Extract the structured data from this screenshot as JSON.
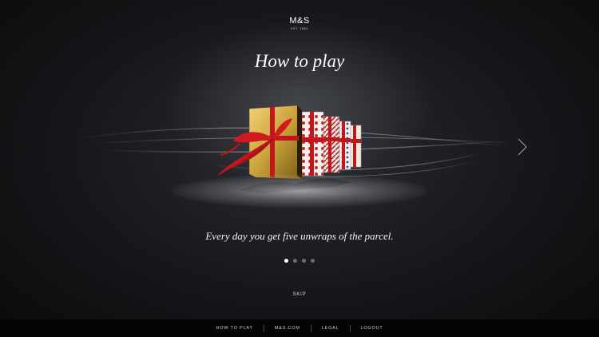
{
  "brand": {
    "name": "M&S",
    "tagline": "EST. 1884"
  },
  "title": "How to play",
  "caption": "Every day you get five unwraps of the parcel.",
  "pagination": {
    "total": 4,
    "active": 1
  },
  "skip_label": "SKIP",
  "next_icon": "chevron-right-icon",
  "footer": {
    "links": [
      "HOW TO PLAY",
      "M&S.COM",
      "LEGAL",
      "LOGOUT"
    ]
  },
  "colors": {
    "background": "#16171a",
    "text": "#ffffff",
    "ribbon": "#c0161c",
    "gold": "#c9a23a"
  }
}
